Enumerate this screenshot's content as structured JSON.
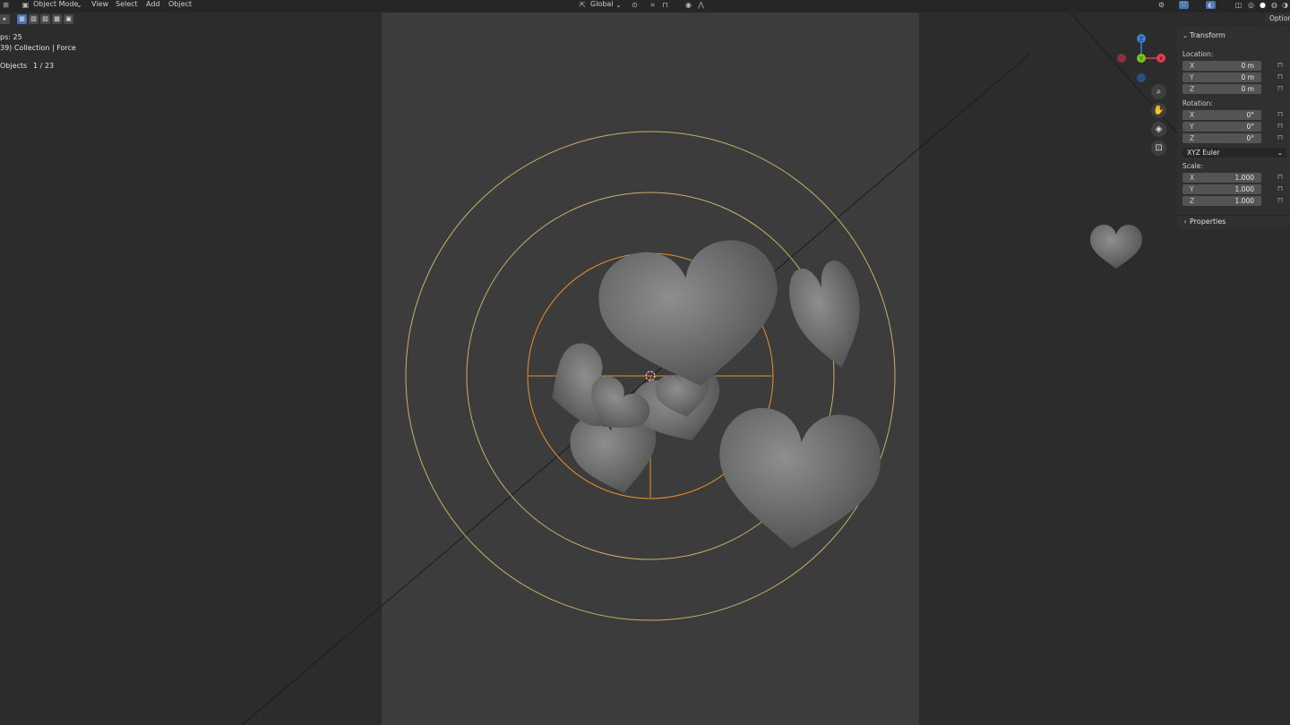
{
  "header": {
    "mode_label": "Object Mode",
    "menus": [
      "View",
      "Select",
      "Add",
      "Object"
    ],
    "orientation_label": "Global"
  },
  "overlay": {
    "line1": "ps: 25",
    "line2": "39) Collection | Force",
    "line3_label": "Objects",
    "line3_value": "1 / 23"
  },
  "gizmo": {
    "z": "Z",
    "y": "Y",
    "x": "X"
  },
  "options_label": "Options",
  "transform_panel": {
    "title": "Transform",
    "location_label": "Location:",
    "location": [
      {
        "axis": "X",
        "value": "0 m"
      },
      {
        "axis": "Y",
        "value": "0 m"
      },
      {
        "axis": "Z",
        "value": "0 m"
      }
    ],
    "rotation_label": "Rotation:",
    "rotation": [
      {
        "axis": "X",
        "value": "0°"
      },
      {
        "axis": "Y",
        "value": "0°"
      },
      {
        "axis": "Z",
        "value": "0°"
      }
    ],
    "rotation_mode": "XYZ Euler",
    "scale_label": "Scale:",
    "scale": [
      {
        "axis": "X",
        "value": "1.000"
      },
      {
        "axis": "Y",
        "value": "1.000"
      },
      {
        "axis": "Z",
        "value": "1.000"
      }
    ]
  },
  "properties_panel": {
    "title": "Properties"
  },
  "icons": [
    "cursor-tool-icon",
    "select-box-icon",
    "zoom-icon",
    "hand-pan-icon",
    "camera-view-icon",
    "lock-icon",
    "transform-orientation-icon",
    "snap-icon",
    "proportional-edit-icon"
  ],
  "colors": {
    "viewport_bg": "#2c2c2c",
    "camera_frame_bg": "#3c3c3c",
    "force_field_ring": "#c8b06a",
    "selected_outline": "#e8902c",
    "heart_gray": "#6e6e6e",
    "panel_bg": "#303030",
    "field_bg": "#545454",
    "accent_blue": "#4772b3",
    "axis_x": "#e04050",
    "axis_y": "#80c020",
    "axis_z": "#3a80d0"
  }
}
